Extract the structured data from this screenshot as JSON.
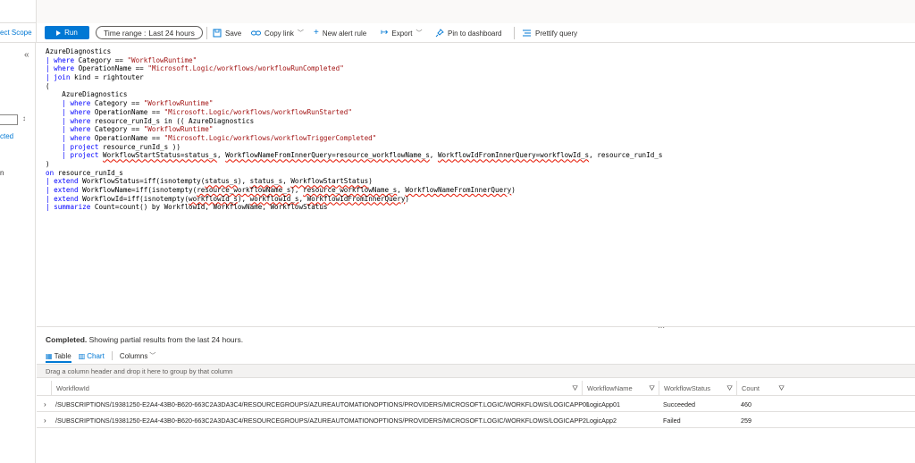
{
  "toolbar": {
    "select_scope": "ect Scope",
    "run": "Run",
    "time_range_label": "Time range :",
    "time_range_value": "Last 24 hours",
    "save": "Save",
    "copy_link": "Copy link",
    "new_alert_rule": "New alert rule",
    "export": "Export",
    "pin_to_dashboard": "Pin to dashboard",
    "prettify_query": "Prettify query"
  },
  "left_panel": {
    "collapse_glyph": "«",
    "sort_glyph": "↕",
    "text1": "cted",
    "text2": "n"
  },
  "query_lines": [
    [
      {
        "t": "AzureDiagnostics"
      }
    ],
    [
      {
        "t": "| ",
        "c": "pipe"
      },
      {
        "t": "where",
        "c": "kw"
      },
      {
        "t": " Category == "
      },
      {
        "t": "\"WorkflowRuntime\"",
        "c": "str"
      }
    ],
    [
      {
        "t": "| ",
        "c": "pipe"
      },
      {
        "t": "where",
        "c": "kw"
      },
      {
        "t": " OperationName == "
      },
      {
        "t": "\"Microsoft.Logic/workflows/workflowRunCompleted\"",
        "c": "str"
      }
    ],
    [
      {
        "t": "| ",
        "c": "pipe"
      },
      {
        "t": "join",
        "c": "kw"
      },
      {
        "t": " kind = rightouter"
      }
    ],
    [
      {
        "t": "("
      }
    ],
    [
      {
        "t": "    AzureDiagnostics"
      }
    ],
    [
      {
        "t": "    | ",
        "c": "pipe"
      },
      {
        "t": "where",
        "c": "kw"
      },
      {
        "t": " Category == "
      },
      {
        "t": "\"WorkflowRuntime\"",
        "c": "str"
      }
    ],
    [
      {
        "t": "    | ",
        "c": "pipe"
      },
      {
        "t": "where",
        "c": "kw"
      },
      {
        "t": " OperationName == "
      },
      {
        "t": "\"Microsoft.Logic/workflows/workflowRunStarted\"",
        "c": "str"
      }
    ],
    [
      {
        "t": "    | ",
        "c": "pipe"
      },
      {
        "t": "where",
        "c": "kw"
      },
      {
        "t": " resource_runId_s in (( AzureDiagnostics"
      }
    ],
    [
      {
        "t": "    | ",
        "c": "pipe"
      },
      {
        "t": "where",
        "c": "kw"
      },
      {
        "t": " Category == "
      },
      {
        "t": "\"WorkflowRuntime\"",
        "c": "str"
      }
    ],
    [
      {
        "t": "    | ",
        "c": "pipe"
      },
      {
        "t": "where",
        "c": "kw"
      },
      {
        "t": " OperationName == "
      },
      {
        "t": "\"Microsoft.Logic/workflows/workflowTriggerCompleted\"",
        "c": "str"
      }
    ],
    [
      {
        "t": "    | ",
        "c": "pipe"
      },
      {
        "t": "project",
        "c": "kw"
      },
      {
        "t": " resource_runId_s ))"
      }
    ],
    [
      {
        "t": "    | ",
        "c": "pipe"
      },
      {
        "t": "project",
        "c": "kw"
      },
      {
        "t": " "
      },
      {
        "t": "WorkflowStartStatus=status_s",
        "c": "err"
      },
      {
        "t": ", "
      },
      {
        "t": "WorkflowNameFromInnerQuery=resource_workflowName_s",
        "c": "err"
      },
      {
        "t": ", "
      },
      {
        "t": "WorkflowIdFromInnerQuery=workflowId_s",
        "c": "err"
      },
      {
        "t": ", resource_runId_s"
      }
    ],
    [
      {
        "t": ")"
      }
    ],
    [
      {
        "t": "on",
        "c": "kw"
      },
      {
        "t": " resource_runId_s"
      }
    ],
    [
      {
        "t": "| ",
        "c": "pipe"
      },
      {
        "t": "extend",
        "c": "kw"
      },
      {
        "t": " WorkflowStatus=iff(isnotempty("
      },
      {
        "t": "status_s",
        "c": "err"
      },
      {
        "t": "), "
      },
      {
        "t": "status_s",
        "c": "err"
      },
      {
        "t": ", "
      },
      {
        "t": "WorkflowStartStatus",
        "c": "err"
      },
      {
        "t": ")"
      }
    ],
    [
      {
        "t": "| ",
        "c": "pipe"
      },
      {
        "t": "extend",
        "c": "kw"
      },
      {
        "t": " WorkflowName=iff(isnotempty("
      },
      {
        "t": "resource_workflowName_s",
        "c": "err"
      },
      {
        "t": "), "
      },
      {
        "t": "resource_workflowName_s",
        "c": "err"
      },
      {
        "t": ", "
      },
      {
        "t": "WorkflowNameFromInnerQuery",
        "c": "err"
      },
      {
        "t": ")"
      }
    ],
    [
      {
        "t": "| ",
        "c": "pipe"
      },
      {
        "t": "extend",
        "c": "kw"
      },
      {
        "t": " WorkflowId=iff(isnotempty("
      },
      {
        "t": "workflowId_s",
        "c": "err"
      },
      {
        "t": "), "
      },
      {
        "t": "workflowId_s",
        "c": "err"
      },
      {
        "t": ", "
      },
      {
        "t": "WorkflowIdFromInnerQuery",
        "c": "err"
      },
      {
        "t": ")"
      }
    ],
    [
      {
        "t": "| ",
        "c": "pipe"
      },
      {
        "t": "summarize",
        "c": "kw"
      },
      {
        "t": " Count=count() by WorkflowId, WorkflowName, WorkflowStatus"
      }
    ]
  ],
  "results": {
    "status_bold": "Completed.",
    "status_text": " Showing partial results from the last 24 hours.",
    "tab_table": "Table",
    "tab_chart": "Chart",
    "columns_button": "Columns",
    "group_hint": "Drag a column header and drop it here to group by that column",
    "headers": {
      "workflow_id": "WorkflowId",
      "workflow_name": "WorkflowName",
      "workflow_status": "WorkflowStatus",
      "count": "Count"
    },
    "rows": [
      {
        "workflow_id": "/SUBSCRIPTIONS/19381250-E2A4-43B0-B620-663C2A3DA3C4/RESOURCEGROUPS/AZUREAUTOMATIONOPTIONS/PROVIDERS/MICROSOFT.LOGIC/WORKFLOWS/LOGICAPP01",
        "workflow_name": "LogicApp01",
        "workflow_status": "Succeeded",
        "count": "460"
      },
      {
        "workflow_id": "/SUBSCRIPTIONS/19381250-E2A4-43B0-B620-663C2A3DA3C4/RESOURCEGROUPS/AZUREAUTOMATIONOPTIONS/PROVIDERS/MICROSOFT.LOGIC/WORKFLOWS/LOGICAPP2",
        "workflow_name": "LogicApp2",
        "workflow_status": "Failed",
        "count": "259"
      }
    ]
  }
}
